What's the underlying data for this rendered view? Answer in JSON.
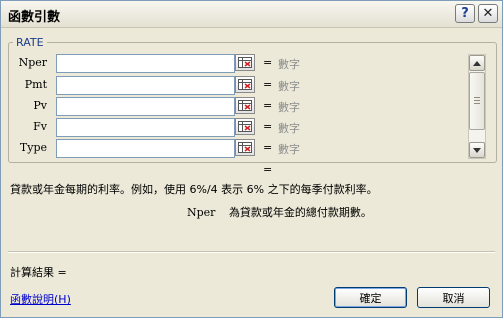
{
  "window": {
    "title": "函數引數",
    "help_label": "?",
    "close_label": "✕"
  },
  "function_name": "RATE",
  "fields": [
    {
      "label": "Nper",
      "value": "",
      "equals": "=",
      "hint": "數字"
    },
    {
      "label": "Pmt",
      "value": "",
      "equals": "=",
      "hint": "數字"
    },
    {
      "label": "Pv",
      "value": "",
      "equals": "=",
      "hint": "數字"
    },
    {
      "label": "Fv",
      "value": "",
      "equals": "=",
      "hint": "數字"
    },
    {
      "label": "Type",
      "value": "",
      "equals": "=",
      "hint": "數字"
    }
  ],
  "result_equals": "=",
  "description": "貸款或年金每期的利率。例如，使用 6%/4 表示 6% 之下的每季付款利率。",
  "param_description": {
    "name": "Nper",
    "text": "為貸款或年金的總付款期數。"
  },
  "calc_result": "計算結果 =",
  "help_link": "函數說明(H)",
  "buttons": {
    "ok": "確定",
    "cancel": "取消"
  }
}
